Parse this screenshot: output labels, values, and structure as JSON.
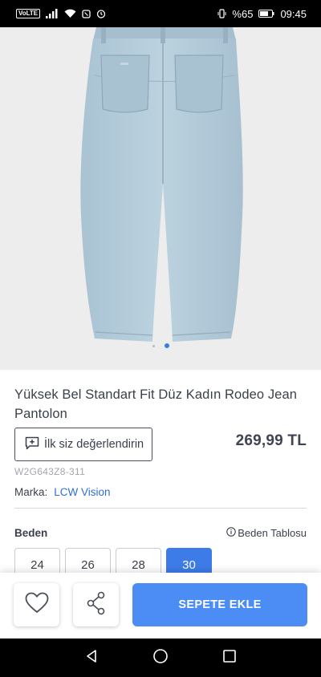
{
  "status_bar": {
    "network": "VoLTE",
    "battery": "%65",
    "time": "09:45"
  },
  "product": {
    "title": "Yüksek Bel Standart Fit Düz Kadın Rodeo Jean Pantolon",
    "rate_button_label": "İlk siz değerlendirin",
    "price": "269,99 TL",
    "sku": "W2G643Z8-311",
    "brand_label": "Marka:",
    "brand_name": "LCW Vision",
    "image_count": 2,
    "active_image": 2
  },
  "sizes": {
    "label": "Beden",
    "table_link": "Beden Tablosu",
    "options": [
      "24",
      "26",
      "28",
      "30"
    ],
    "selected": "30"
  },
  "actions": {
    "favorite_icon": "heart-icon",
    "share_icon": "share-icon",
    "add_to_cart": "SEPETE EKLE"
  },
  "colors": {
    "accent": "#4b8cf5",
    "link": "#2d6fd6",
    "denim": "#b4ccda"
  }
}
